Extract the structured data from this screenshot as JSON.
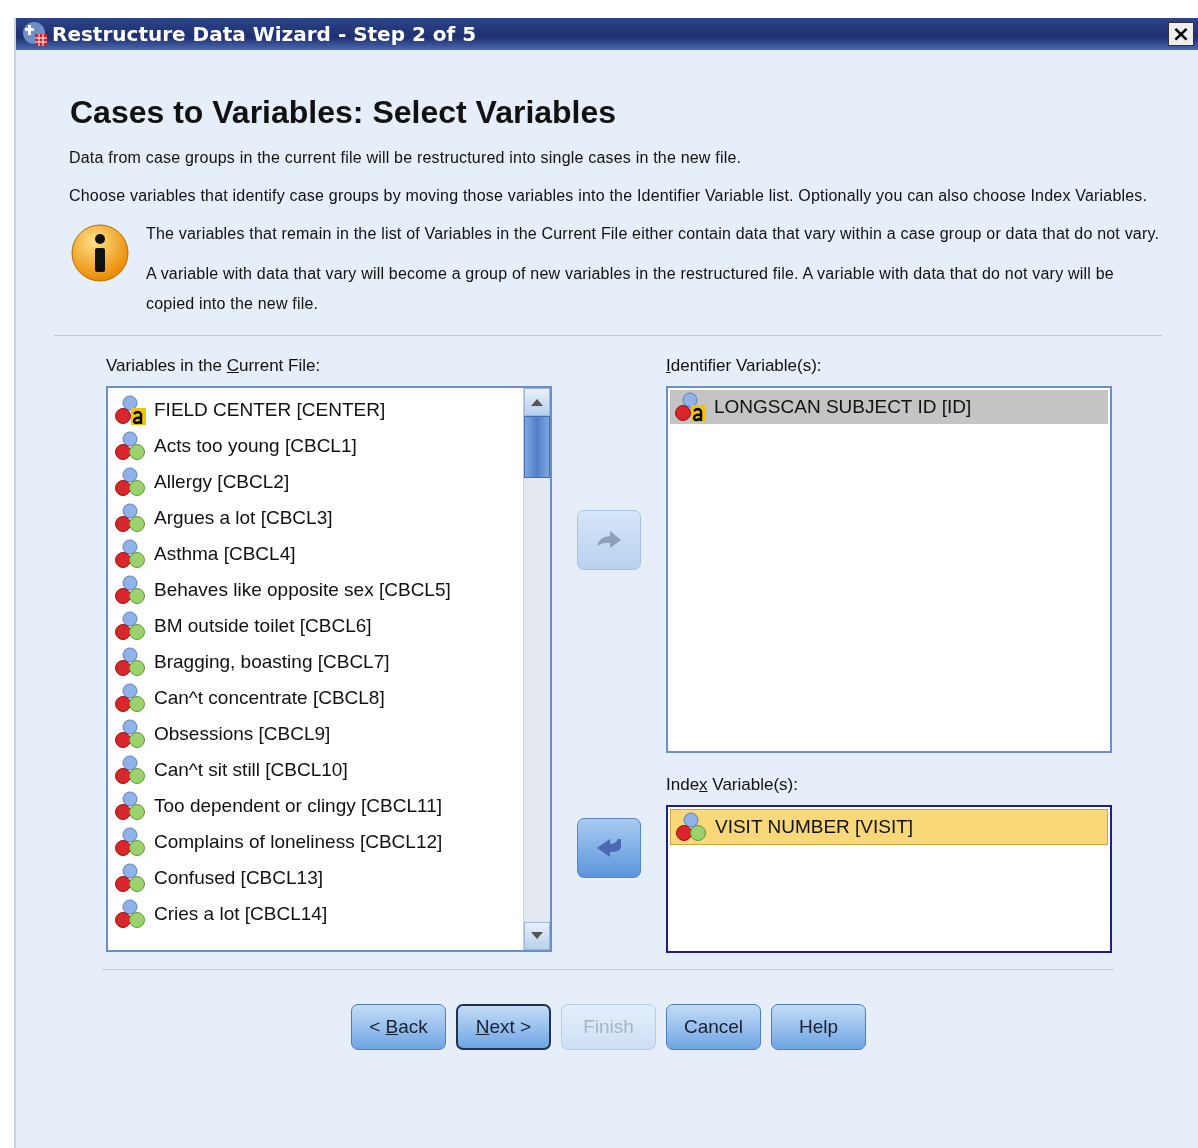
{
  "window": {
    "title": "Restructure Data Wizard - Step 2 of 5",
    "close": "×"
  },
  "heading": "Cases to Variables: Select Variables",
  "intro": [
    "Data from case groups in the current file will be restructured into single cases in the new file.",
    "Choose variables that identify case groups by moving those variables into the Identifier Variable list.  Optionally you can also choose Index Variables."
  ],
  "info": [
    "The variables that remain in the list of Variables in the Current File either contain data that vary within a case group or data that do not vary.",
    "A variable with data that vary will become a group of new variables in the restructured file.  A variable with data that do not vary will be copied into the new file."
  ],
  "source_list": {
    "label": {
      "before": "Variables in the ",
      "key": "C",
      "after": "urrent File:"
    },
    "focused": false,
    "items": [
      {
        "kind": "string",
        "text": "FIELD CENTER [CENTER]",
        "selected": false
      },
      {
        "kind": "nominal",
        "text": "Acts too young [CBCL1]",
        "selected": false
      },
      {
        "kind": "nominal",
        "text": "Allergy [CBCL2]",
        "selected": false
      },
      {
        "kind": "nominal",
        "text": "Argues a lot [CBCL3]",
        "selected": false
      },
      {
        "kind": "nominal",
        "text": "Asthma [CBCL4]",
        "selected": false
      },
      {
        "kind": "nominal",
        "text": "Behaves like opposite sex [CBCL5]",
        "selected": false
      },
      {
        "kind": "nominal",
        "text": "BM outside toilet [CBCL6]",
        "selected": false
      },
      {
        "kind": "nominal",
        "text": "Bragging, boasting [CBCL7]",
        "selected": false
      },
      {
        "kind": "nominal",
        "text": "Can^t concentrate [CBCL8]",
        "selected": false
      },
      {
        "kind": "nominal",
        "text": "Obsessions [CBCL9]",
        "selected": false
      },
      {
        "kind": "nominal",
        "text": "Can^t sit still [CBCL10]",
        "selected": false
      },
      {
        "kind": "nominal",
        "text": "Too dependent or clingy [CBCL11]",
        "selected": false
      },
      {
        "kind": "nominal",
        "text": "Complains of loneliness [CBCL12]",
        "selected": false
      },
      {
        "kind": "nominal",
        "text": "Confused [CBCL13]",
        "selected": false
      },
      {
        "kind": "nominal",
        "text": "Cries a lot [CBCL14]",
        "selected": false
      }
    ]
  },
  "move_buttons": [
    {
      "kind": "right",
      "disabled": true
    },
    {
      "kind": "left",
      "disabled": false
    }
  ],
  "identifier_list": {
    "label": {
      "key": "I",
      "after": "dentifier Variable(s):"
    },
    "focused": false,
    "items": [
      {
        "kind": "string",
        "text": "LONGSCAN SUBJECT ID [ID]",
        "selected": true
      }
    ]
  },
  "index_list": {
    "label": {
      "before": "Inde",
      "key": "x",
      "after": " Variable(s):"
    },
    "focused": true,
    "items": [
      {
        "kind": "nominal",
        "text": "VISIT NUMBER [VISIT]",
        "selected": true
      }
    ]
  },
  "buttons": [
    {
      "before": "< ",
      "key": "B",
      "after": "ack",
      "disabled": false,
      "default": false
    },
    {
      "key": "N",
      "after": "ext  >",
      "disabled": false,
      "default": true
    },
    {
      "before": "Finish",
      "disabled": true,
      "default": false
    },
    {
      "before": "Cancel",
      "disabled": false,
      "default": false
    },
    {
      "before": "Help",
      "disabled": false,
      "default": false
    }
  ]
}
